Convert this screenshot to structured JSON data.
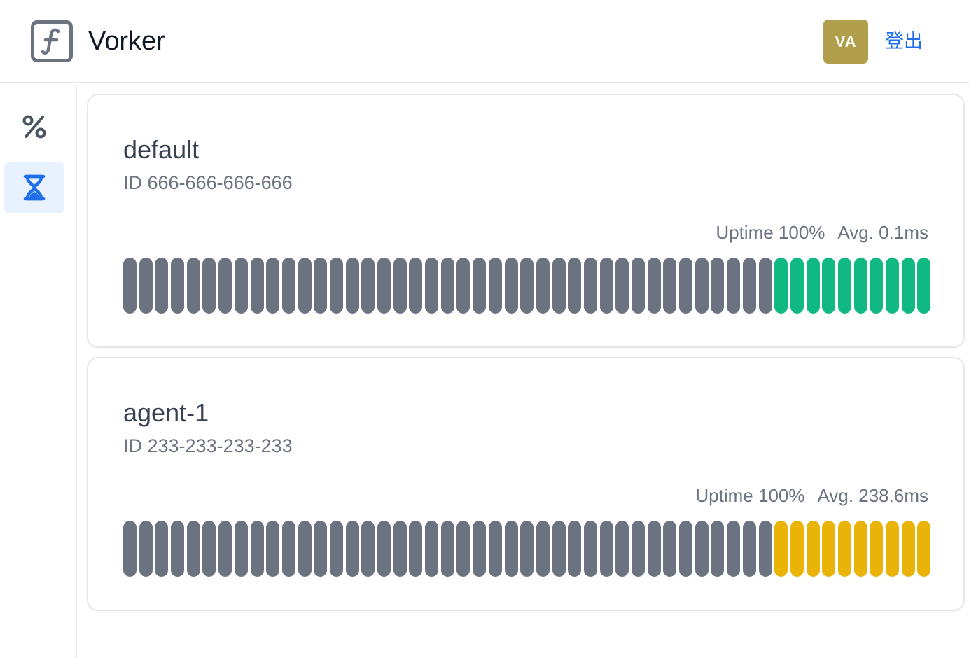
{
  "app": {
    "title": "Vorker"
  },
  "user": {
    "initials": "VA",
    "logout_label": "登出"
  },
  "colors": {
    "bar_empty": "#6b7280",
    "bar_ok": "#10b981",
    "bar_warn": "#eab308",
    "accent": "#1f6feb",
    "avatar_bg": "#b09e4a"
  },
  "sidebar": {
    "items": [
      {
        "icon": "percent-icon",
        "active": false
      },
      {
        "icon": "hourglass-icon",
        "active": true
      }
    ]
  },
  "nodes": [
    {
      "name": "default",
      "id_text": "ID 666-666-666-666",
      "uptime_text": "Uptime 100%",
      "avg_text": "Avg. 0.1ms",
      "total_bars": 51,
      "filled_bars": 10,
      "status": "ok"
    },
    {
      "name": "agent-1",
      "id_text": "ID 233-233-233-233",
      "uptime_text": "Uptime 100%",
      "avg_text": "Avg. 238.6ms",
      "total_bars": 51,
      "filled_bars": 10,
      "status": "warn"
    }
  ]
}
